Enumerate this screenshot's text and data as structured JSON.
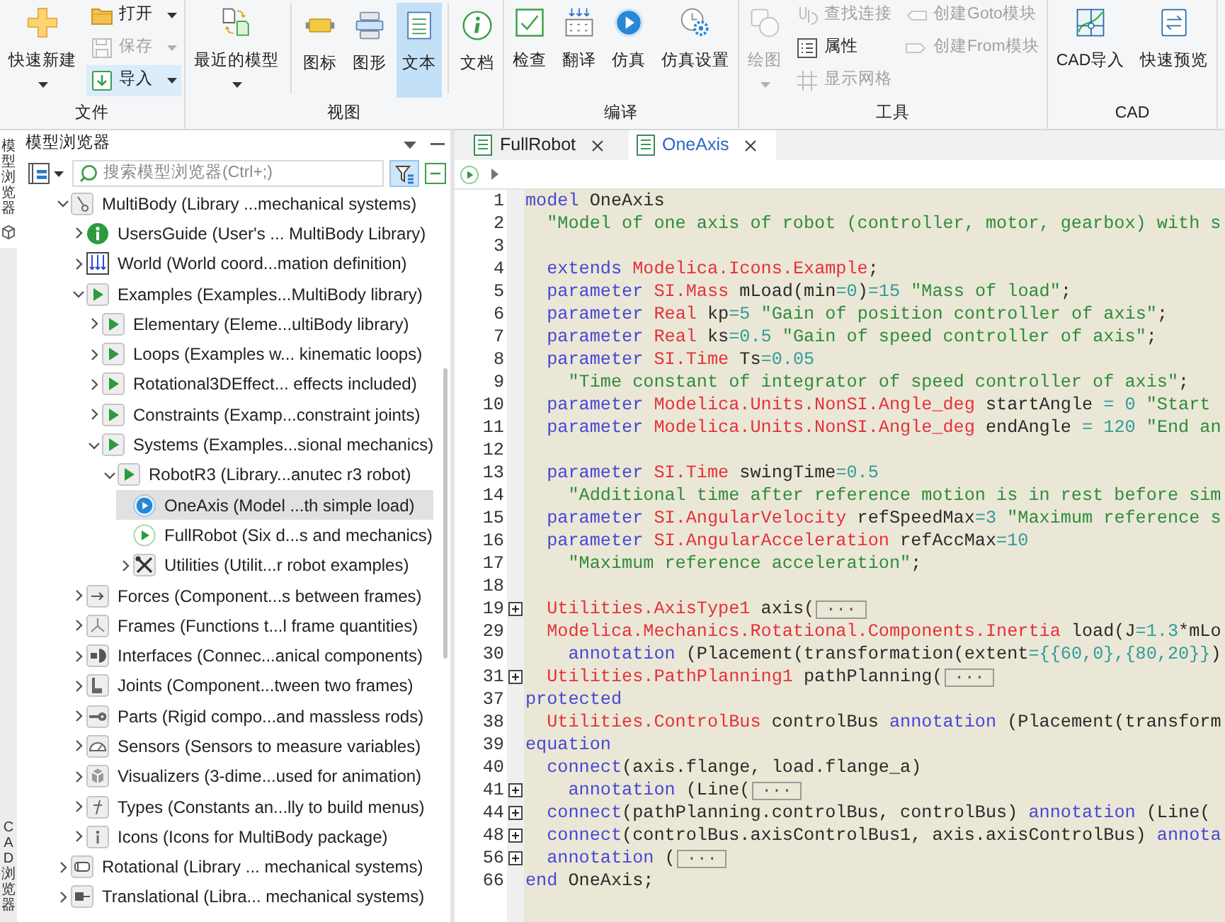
{
  "side_tabs": [
    {
      "label": "模型浏览器",
      "selected": true
    },
    {
      "label": "CAD浏览器",
      "selected": false
    }
  ],
  "ribbon": {
    "groups": [
      {
        "label": "文件",
        "sections": [
          {
            "buttons": [
              {
                "kind": "large",
                "label": "快速新建",
                "dropdown": true,
                "disabled": false,
                "selected": false,
                "highlighted": false
              },
              {
                "kind": "small",
                "label": "打开",
                "dropdown": true,
                "disabled": false,
                "selected": false,
                "highlighted": false
              },
              {
                "kind": "small",
                "label": "保存",
                "dropdown": true,
                "disabled": true,
                "selected": false,
                "highlighted": false
              },
              {
                "kind": "small",
                "label": "导入",
                "dropdown": true,
                "disabled": false,
                "selected": false,
                "highlighted": true
              }
            ]
          }
        ]
      },
      {
        "label": "视图",
        "sections": [
          {
            "buttons": [
              {
                "kind": "large",
                "label": "最近的模型",
                "dropdown": true,
                "disabled": false,
                "selected": false,
                "highlighted": false
              }
            ]
          },
          {
            "buttons": [
              {
                "kind": "large",
                "label": "图标",
                "dropdown": false,
                "disabled": false,
                "selected": false,
                "highlighted": false
              },
              {
                "kind": "large",
                "label": "图形",
                "dropdown": false,
                "disabled": false,
                "selected": false,
                "highlighted": false
              },
              {
                "kind": "large",
                "label": "文本",
                "dropdown": false,
                "disabled": false,
                "selected": true,
                "highlighted": false
              }
            ]
          },
          {
            "buttons": [
              {
                "kind": "large",
                "label": "文档",
                "dropdown": false,
                "disabled": false,
                "selected": false,
                "highlighted": false
              }
            ]
          }
        ]
      },
      {
        "label": "编译",
        "sections": [
          {
            "buttons": [
              {
                "kind": "large",
                "label": "检查",
                "dropdown": false,
                "disabled": false,
                "selected": false,
                "highlighted": false
              },
              {
                "kind": "large",
                "label": "翻译",
                "dropdown": false,
                "disabled": false,
                "selected": false,
                "highlighted": false
              },
              {
                "kind": "large",
                "label": "仿真",
                "dropdown": false,
                "disabled": false,
                "selected": false,
                "highlighted": false
              },
              {
                "kind": "large",
                "label": "仿真设置",
                "dropdown": false,
                "disabled": false,
                "selected": false,
                "highlighted": false
              }
            ]
          }
        ]
      },
      {
        "label": "工具",
        "sections": [
          {
            "buttons": [
              {
                "kind": "large",
                "label": "绘图",
                "dropdown": true,
                "disabled": true,
                "selected": false,
                "highlighted": false
              },
              {
                "kind": "small",
                "label": "查找连接",
                "dropdown": false,
                "disabled": true,
                "selected": false,
                "highlighted": false
              },
              {
                "kind": "small",
                "label": "属性",
                "dropdown": false,
                "disabled": false,
                "selected": false,
                "highlighted": false
              },
              {
                "kind": "small",
                "label": "显示网格",
                "dropdown": false,
                "disabled": true,
                "selected": false,
                "highlighted": false
              },
              {
                "kind": "small",
                "label": "创建Goto模块",
                "dropdown": false,
                "disabled": true,
                "selected": false,
                "highlighted": false
              },
              {
                "kind": "small",
                "label": "创建From模块",
                "dropdown": false,
                "disabled": true,
                "selected": false,
                "highlighted": false
              }
            ]
          }
        ]
      },
      {
        "label": "CAD",
        "sections": [
          {
            "buttons": [
              {
                "kind": "large",
                "label": "CAD导入",
                "dropdown": false,
                "disabled": false,
                "selected": false,
                "highlighted": false
              },
              {
                "kind": "large",
                "label": "快速预览",
                "dropdown": false,
                "disabled": false,
                "selected": false,
                "highlighted": false
              }
            ]
          }
        ]
      }
    ]
  },
  "model_browser": {
    "title": "模型浏览器",
    "search": {
      "placeholder": "搜索模型浏览器(Ctrl+;)"
    },
    "filter": {
      "active": true
    },
    "tree": [
      {
        "label": "MultiBody (Library ...mechanical systems)",
        "expanded": true,
        "selected": false,
        "children": [
          {
            "label": "UsersGuide (User's ... MultiBody Library)",
            "expanded": false,
            "selected": false
          },
          {
            "label": "World (World coord...mation definition)",
            "expanded": false,
            "selected": false
          },
          {
            "label": "Examples (Examples...MultiBody library)",
            "expanded": true,
            "selected": false,
            "children": [
              {
                "label": "Elementary (Eleme...ultiBody library)",
                "expanded": false,
                "selected": false
              },
              {
                "label": "Loops (Examples w... kinematic loops)",
                "expanded": false,
                "selected": false
              },
              {
                "label": "Rotational3DEffect... effects included)",
                "expanded": false,
                "selected": false
              },
              {
                "label": "Constraints (Examp...constraint joints)",
                "expanded": false,
                "selected": false
              },
              {
                "label": "Systems (Examples...sional mechanics)",
                "expanded": true,
                "selected": false,
                "children": [
                  {
                    "label": "RobotR3 (Library...anutec r3 robot)",
                    "expanded": true,
                    "selected": false,
                    "children": [
                      {
                        "label": "OneAxis (Model ...th simple load)",
                        "selected": true
                      },
                      {
                        "label": "FullRobot (Six d...s and mechanics)",
                        "selected": false
                      },
                      {
                        "label": "Utilities (Utilit...r robot examples)",
                        "expanded": false,
                        "selected": false
                      }
                    ]
                  }
                ]
              }
            ]
          },
          {
            "label": "Forces (Component...s between frames)",
            "expanded": false,
            "selected": false
          },
          {
            "label": "Frames (Functions t...l frame quantities)",
            "expanded": false,
            "selected": false
          },
          {
            "label": "Interfaces (Connec...anical components)",
            "expanded": false,
            "selected": false
          },
          {
            "label": "Joints (Component...tween two frames)",
            "expanded": false,
            "selected": false
          },
          {
            "label": "Parts (Rigid compo...and massless rods)",
            "expanded": false,
            "selected": false
          },
          {
            "label": "Sensors (Sensors to measure variables)",
            "expanded": false,
            "selected": false
          },
          {
            "label": "Visualizers (3-dime...used for animation)",
            "expanded": false,
            "selected": false
          },
          {
            "label": "Types (Constants an...lly to build menus)",
            "expanded": false,
            "selected": false
          },
          {
            "label": "Icons (Icons for MultiBody package)",
            "expanded": false,
            "selected": false
          }
        ]
      },
      {
        "label": "Rotational (Library ... mechanical systems)",
        "expanded": false,
        "selected": false
      },
      {
        "label": "Translational (Libra... mechanical systems)",
        "expanded": false,
        "selected": false
      }
    ]
  },
  "editor": {
    "tabs": [
      {
        "label": "FullRobot",
        "selected": false
      },
      {
        "label": "OneAxis",
        "selected": true
      }
    ],
    "lines": [
      {
        "number": "1",
        "tokens": [
          {
            "kind": "keyword",
            "text": "model"
          },
          {
            "kind": "plain",
            "text": " OneAxis"
          }
        ]
      },
      {
        "number": "2",
        "tokens": [
          {
            "kind": "string",
            "text": "  \"Model of one axis of robot (controller, motor, gearbox) with s"
          }
        ]
      },
      {
        "number": "3"
      },
      {
        "number": "4",
        "tokens": [
          {
            "kind": "keyword",
            "text": "  extends"
          },
          {
            "kind": "type",
            "text": " Modelica.Icons.Example"
          },
          {
            "kind": "plain",
            "text": ";"
          }
        ]
      },
      {
        "number": "5",
        "tokens": [
          {
            "kind": "keyword",
            "text": "  parameter"
          },
          {
            "kind": "type",
            "text": " SI.Mass"
          },
          {
            "kind": "plain",
            "text": " mLoad(min"
          },
          {
            "kind": "number",
            "text": "=0"
          },
          {
            "kind": "plain",
            "text": ")"
          },
          {
            "kind": "number",
            "text": "=15"
          },
          {
            "kind": "string",
            "text": " \"Mass of load\""
          },
          {
            "kind": "plain",
            "text": ";"
          }
        ]
      },
      {
        "number": "6",
        "tokens": [
          {
            "kind": "keyword",
            "text": "  parameter"
          },
          {
            "kind": "type",
            "text": " Real"
          },
          {
            "kind": "plain",
            "text": " kp"
          },
          {
            "kind": "number",
            "text": "=5"
          },
          {
            "kind": "string",
            "text": " \"Gain of position controller of axis\""
          },
          {
            "kind": "plain",
            "text": ";"
          }
        ]
      },
      {
        "number": "7",
        "tokens": [
          {
            "kind": "keyword",
            "text": "  parameter"
          },
          {
            "kind": "type",
            "text": " Real"
          },
          {
            "kind": "plain",
            "text": " ks"
          },
          {
            "kind": "number",
            "text": "=0.5"
          },
          {
            "kind": "string",
            "text": " \"Gain of speed controller of axis\""
          },
          {
            "kind": "plain",
            "text": ";"
          }
        ]
      },
      {
        "number": "8",
        "tokens": [
          {
            "kind": "keyword",
            "text": "  parameter"
          },
          {
            "kind": "type",
            "text": " SI.Time"
          },
          {
            "kind": "plain",
            "text": " Ts"
          },
          {
            "kind": "number",
            "text": "=0.05"
          }
        ]
      },
      {
        "number": "9",
        "tokens": [
          {
            "kind": "string",
            "text": "    \"Time constant of integrator of speed controller of axis\""
          },
          {
            "kind": "plain",
            "text": ";"
          }
        ]
      },
      {
        "number": "10",
        "tokens": [
          {
            "kind": "keyword",
            "text": "  parameter"
          },
          {
            "kind": "type",
            "text": " Modelica.Units.NonSI.Angle_deg"
          },
          {
            "kind": "plain",
            "text": " startAngle"
          },
          {
            "kind": "number",
            "text": " = 0"
          },
          {
            "kind": "string",
            "text": " \"Start"
          }
        ]
      },
      {
        "number": "11",
        "tokens": [
          {
            "kind": "keyword",
            "text": "  parameter"
          },
          {
            "kind": "type",
            "text": " Modelica.Units.NonSI.Angle_deg"
          },
          {
            "kind": "plain",
            "text": " endAngle"
          },
          {
            "kind": "number",
            "text": " = 120"
          },
          {
            "kind": "string",
            "text": " \"End an"
          }
        ]
      },
      {
        "number": "12"
      },
      {
        "number": "13",
        "tokens": [
          {
            "kind": "keyword",
            "text": "  parameter"
          },
          {
            "kind": "type",
            "text": " SI.Time"
          },
          {
            "kind": "plain",
            "text": " swingTime"
          },
          {
            "kind": "number",
            "text": "=0.5"
          }
        ]
      },
      {
        "number": "14",
        "tokens": [
          {
            "kind": "string",
            "text": "    \"Additional time after reference motion is in rest before sim"
          }
        ]
      },
      {
        "number": "15",
        "tokens": [
          {
            "kind": "keyword",
            "text": "  parameter"
          },
          {
            "kind": "type",
            "text": " SI.AngularVelocity"
          },
          {
            "kind": "plain",
            "text": " refSpeedMax"
          },
          {
            "kind": "number",
            "text": "=3"
          },
          {
            "kind": "string",
            "text": " \"Maximum reference s"
          }
        ]
      },
      {
        "number": "16",
        "tokens": [
          {
            "kind": "keyword",
            "text": "  parameter"
          },
          {
            "kind": "type",
            "text": " SI.AngularAcceleration"
          },
          {
            "kind": "plain",
            "text": " refAccMax"
          },
          {
            "kind": "number",
            "text": "=10"
          }
        ]
      },
      {
        "number": "17",
        "tokens": [
          {
            "kind": "string",
            "text": "    \"Maximum reference acceleration\""
          },
          {
            "kind": "plain",
            "text": ";"
          }
        ]
      },
      {
        "number": "18"
      },
      {
        "number": "19",
        "expanded": false,
        "folded_text": "...",
        "tokens": [
          {
            "kind": "type",
            "text": "  Utilities.AxisType1"
          },
          {
            "kind": "plain",
            "text": " axis("
          }
        ]
      },
      {
        "number": "29",
        "tokens": [
          {
            "kind": "type",
            "text": "  Modelica.Mechanics.Rotational.Components.Inertia"
          },
          {
            "kind": "plain",
            "text": " load(J"
          },
          {
            "kind": "number",
            "text": "=1.3"
          },
          {
            "kind": "plain",
            "text": "*mLo"
          }
        ]
      },
      {
        "number": "30",
        "tokens": [
          {
            "kind": "keyword",
            "text": "    annotation"
          },
          {
            "kind": "plain",
            "text": " (Placement(transformation(extent"
          },
          {
            "kind": "number",
            "text": "={{60,0},{80,20}}"
          },
          {
            "kind": "plain",
            "text": ")"
          }
        ]
      },
      {
        "number": "31",
        "expanded": false,
        "folded_text": "...",
        "tokens": [
          {
            "kind": "type",
            "text": "  Utilities.PathPlanning1"
          },
          {
            "kind": "plain",
            "text": " pathPlanning("
          }
        ]
      },
      {
        "number": "37",
        "tokens": [
          {
            "kind": "keyword",
            "text": "protected"
          }
        ]
      },
      {
        "number": "38",
        "tokens": [
          {
            "kind": "type",
            "text": "  Utilities.ControlBus"
          },
          {
            "kind": "plain",
            "text": " controlBus"
          },
          {
            "kind": "keyword",
            "text": " annotation"
          },
          {
            "kind": "plain",
            "text": " (Placement(transform"
          }
        ]
      },
      {
        "number": "39",
        "tokens": [
          {
            "kind": "keyword",
            "text": "equation"
          }
        ]
      },
      {
        "number": "40",
        "tokens": [
          {
            "kind": "keyword",
            "text": "  connect"
          },
          {
            "kind": "plain",
            "text": "(axis.flange, load.flange_a)"
          }
        ]
      },
      {
        "number": "41",
        "expanded": false,
        "folded_text": "...",
        "tokens": [
          {
            "kind": "keyword",
            "text": "    annotation"
          },
          {
            "kind": "plain",
            "text": " (Line("
          }
        ]
      },
      {
        "number": "44",
        "expanded": false,
        "tokens": [
          {
            "kind": "keyword",
            "text": "  connect"
          },
          {
            "kind": "plain",
            "text": "(pathPlanning.controlBus, controlBus)"
          },
          {
            "kind": "keyword",
            "text": " annotation"
          },
          {
            "kind": "plain",
            "text": " (Line("
          }
        ]
      },
      {
        "number": "48",
        "expanded": false,
        "tokens": [
          {
            "kind": "keyword",
            "text": "  connect"
          },
          {
            "kind": "plain",
            "text": "(controlBus.axisControlBus1, axis.axisControlBus)"
          },
          {
            "kind": "keyword",
            "text": " annota"
          }
        ]
      },
      {
        "number": "56",
        "expanded": false,
        "folded_text": "...",
        "tokens": [
          {
            "kind": "keyword",
            "text": "  annotation"
          },
          {
            "kind": "plain",
            "text": " ("
          }
        ]
      },
      {
        "number": "66",
        "tokens": [
          {
            "kind": "keyword",
            "text": "end"
          },
          {
            "kind": "plain",
            "text": " OneAxis;"
          }
        ]
      }
    ]
  }
}
